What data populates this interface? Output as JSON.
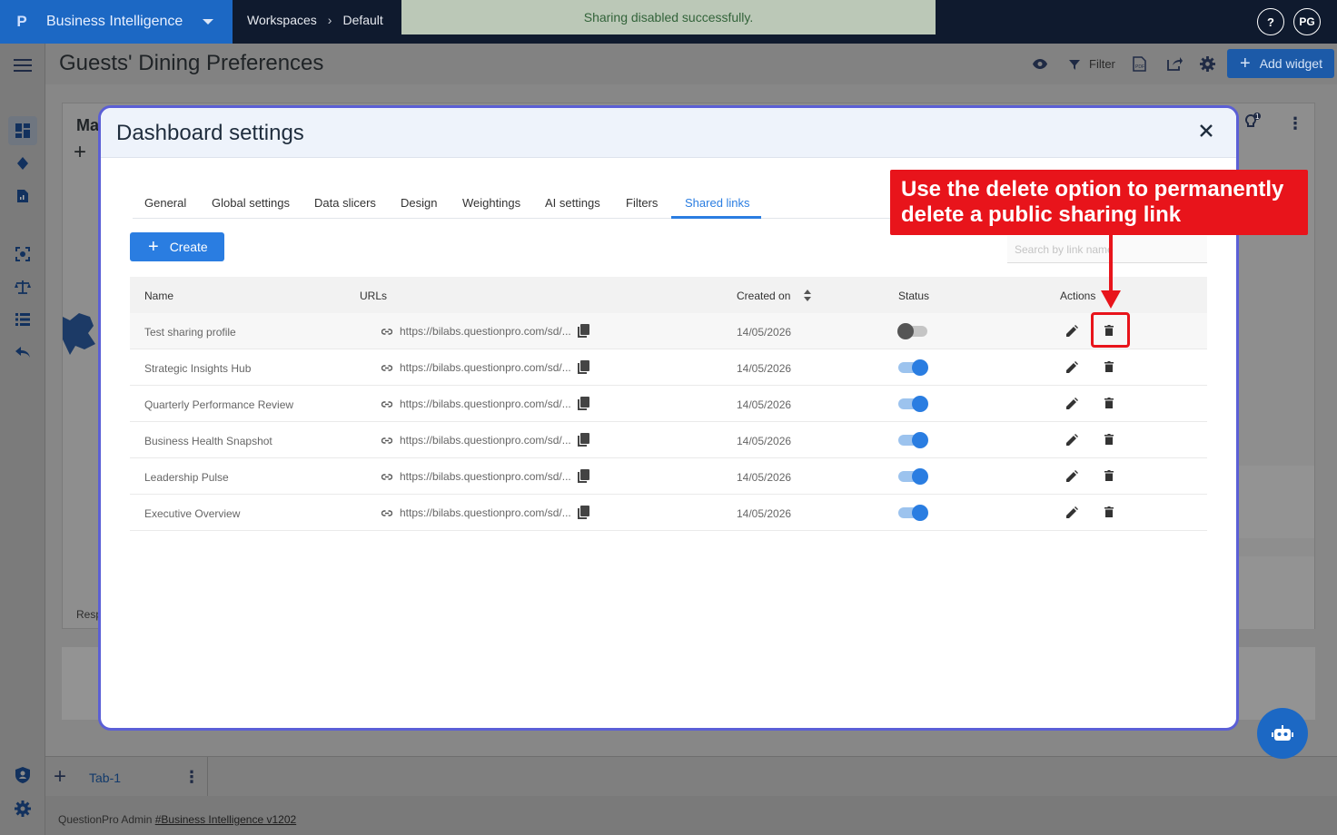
{
  "app": {
    "brand_logo": "P",
    "brand_name": "Business Intelligence",
    "breadcrumbs": [
      "Workspaces",
      "Default"
    ],
    "toast": "Sharing disabled successfully.",
    "help": "?",
    "user_initials": "PG"
  },
  "page": {
    "title": "Guests' Dining Preferences",
    "filter_label": "Filter",
    "add_widget_label": "Add widget"
  },
  "background": {
    "widget_title_partial": "Ma",
    "widget_footer_partial": "Resp",
    "notification_count": "1"
  },
  "bottom_bar": {
    "tab_label": "Tab-1"
  },
  "footer": {
    "prefix": "QuestionPro Admin ",
    "link": "#Business Intelligence v1202"
  },
  "modal": {
    "title": "Dashboard settings",
    "tabs": [
      "General",
      "Global settings",
      "Data slicers",
      "Design",
      "Weightings",
      "AI settings",
      "Filters",
      "Shared links"
    ],
    "active_tab": "Shared links",
    "create_label": "Create",
    "search_placeholder": "Search by link name",
    "columns": {
      "name": "Name",
      "urls": "URLs",
      "created_on": "Created on",
      "status": "Status",
      "actions": "Actions"
    },
    "rows": [
      {
        "name": "Test sharing profile",
        "url": "https://bilabs.questionpro.com/sd/...",
        "created": "14/05/2026",
        "enabled": false
      },
      {
        "name": "Strategic Insights Hub",
        "url": "https://bilabs.questionpro.com/sd/...",
        "created": "14/05/2026",
        "enabled": true
      },
      {
        "name": "Quarterly Performance Review",
        "url": "https://bilabs.questionpro.com/sd/...",
        "created": "14/05/2026",
        "enabled": true
      },
      {
        "name": "Business Health Snapshot",
        "url": "https://bilabs.questionpro.com/sd/...",
        "created": "14/05/2026",
        "enabled": true
      },
      {
        "name": "Leadership Pulse",
        "url": "https://bilabs.questionpro.com/sd/...",
        "created": "14/05/2026",
        "enabled": true
      },
      {
        "name": "Executive Overview",
        "url": "https://bilabs.questionpro.com/sd/...",
        "created": "14/05/2026",
        "enabled": true
      }
    ]
  },
  "annotation": {
    "callout": "Use the delete option to permanently delete a public sharing link"
  },
  "colors": {
    "accent": "#2a7de1",
    "brand": "#1c68c4",
    "callout": "#e8141b",
    "modal_border": "#5b5fd6"
  }
}
